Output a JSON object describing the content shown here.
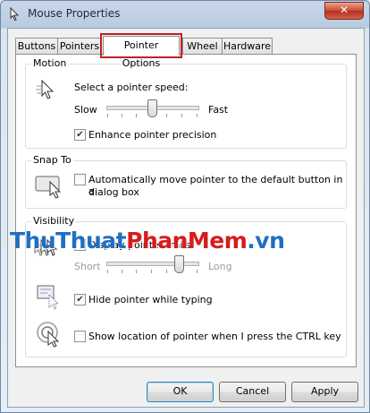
{
  "window": {
    "title": "Mouse Properties",
    "close_label": "✕"
  },
  "tabs": [
    {
      "label": "Buttons"
    },
    {
      "label": "Pointers"
    },
    {
      "label": "Pointer Options",
      "active": true
    },
    {
      "label": "Wheel"
    },
    {
      "label": "Hardware"
    }
  ],
  "motion": {
    "label": "Motion",
    "speed_label": "Select a pointer speed:",
    "slow": "Slow",
    "fast": "Fast",
    "speed_level": 0.5,
    "precision_label": "Enhance pointer precision",
    "precision_checked": true
  },
  "snap": {
    "label": "Snap To",
    "snap_label": "Automatically move pointer to the default button in a",
    "snap_label_2": "dialog box",
    "snap_checked": false
  },
  "visibility": {
    "label": "Visibility",
    "trails_label": "Display pointer trails",
    "trails_checked": false,
    "short": "Short",
    "long": "Long",
    "trail_level": 0.83,
    "hide_label": "Hide pointer while typing",
    "hide_checked": true,
    "ctrl_label": "Show location of pointer when I press the CTRL key",
    "ctrl_checked": false
  },
  "buttons": {
    "ok": "OK",
    "cancel": "Cancel",
    "apply": "Apply"
  },
  "watermark": {
    "part1": "ThuThuat",
    "part2": "PhanMem",
    "part3": ".vn"
  },
  "colors": {
    "tab_highlight": "#c32020",
    "watermark_blue": "#1f6fc2",
    "watermark_red": "#d61c1c"
  }
}
